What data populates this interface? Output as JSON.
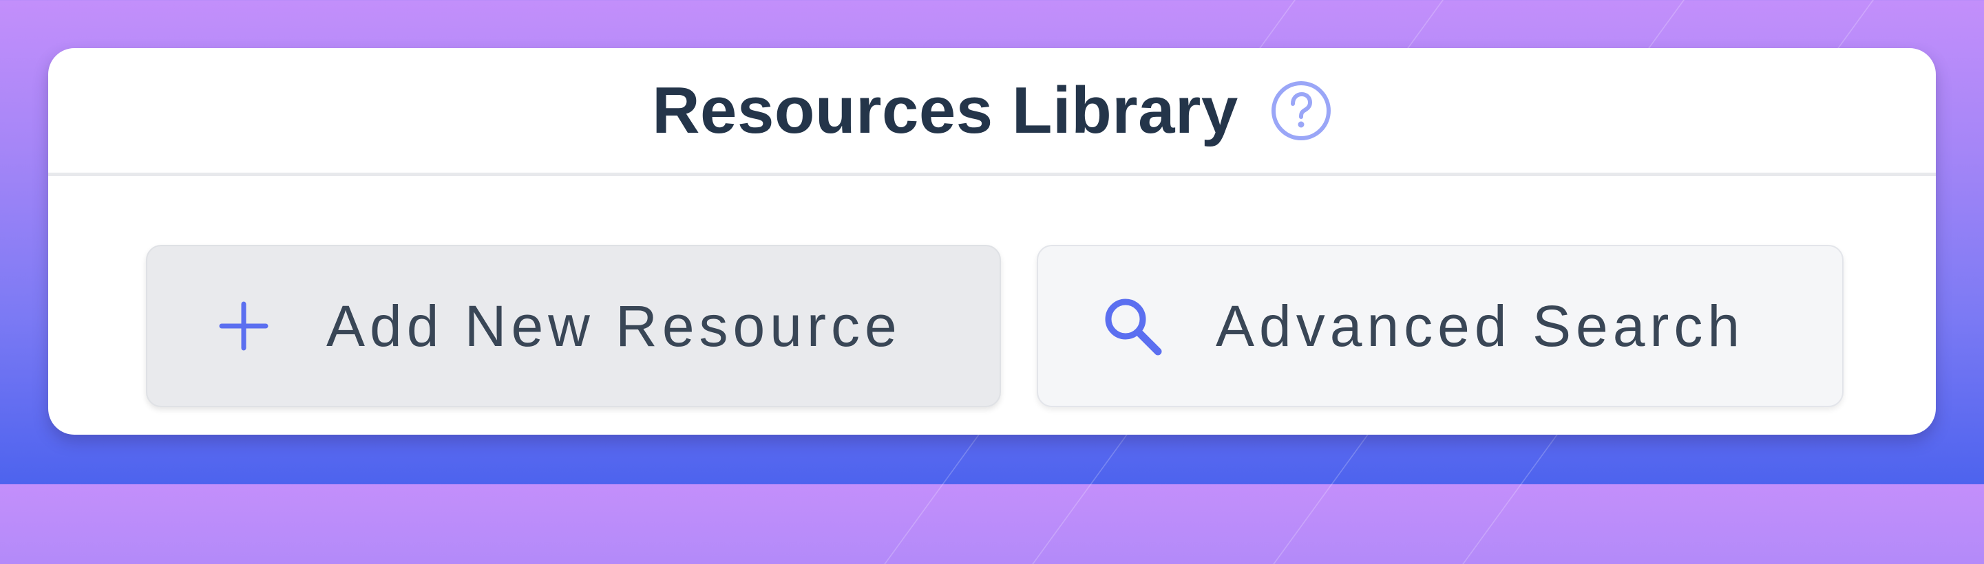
{
  "header": {
    "title": "Resources Library",
    "help_icon": "question-circle-icon"
  },
  "actions": {
    "add_resource": {
      "label": "Add New Resource",
      "icon": "plus-icon"
    },
    "advanced_search": {
      "label": "Advanced Search",
      "icon": "search-icon"
    }
  },
  "colors": {
    "accent": "#5b6ff0",
    "title_text": "#24354a",
    "button_text": "#394656",
    "background_top": "#c38ffb",
    "background_bottom": "#4d63ee"
  }
}
